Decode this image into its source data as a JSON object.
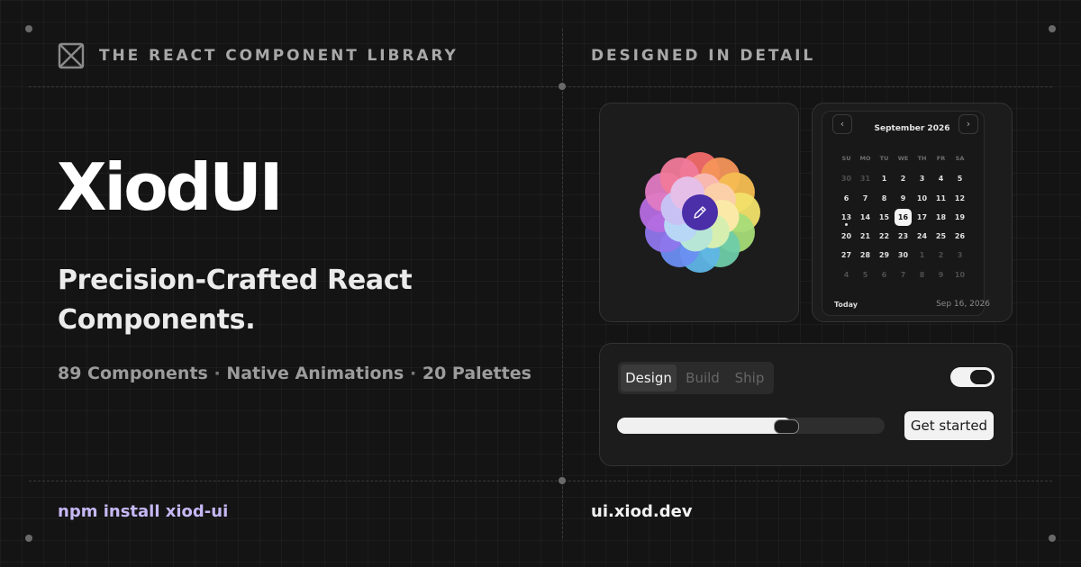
{
  "header": {
    "left_eyebrow": "THE REACT COMPONENT LIBRARY",
    "right_eyebrow": "DESIGNED IN DETAIL"
  },
  "hero": {
    "brand": "XiodUI",
    "tagline": "Precision-Crafted React Components.",
    "features": [
      "89 Components",
      "Native Animations",
      "20 Palettes"
    ],
    "separator": "·"
  },
  "footer": {
    "install": "npm install xiod-ui",
    "url": "ui.xiod.dev"
  },
  "calendar": {
    "month": "September 2026",
    "prev_icon": "chevron-left-icon",
    "next_icon": "chevron-right-icon",
    "weekdays": [
      "SU",
      "MO",
      "TU",
      "WE",
      "TH",
      "FR",
      "SA"
    ],
    "days": [
      {
        "d": "30",
        "muted": true
      },
      {
        "d": "31",
        "muted": true
      },
      {
        "d": "1"
      },
      {
        "d": "2"
      },
      {
        "d": "3"
      },
      {
        "d": "4"
      },
      {
        "d": "5"
      },
      {
        "d": "6"
      },
      {
        "d": "7"
      },
      {
        "d": "8"
      },
      {
        "d": "9"
      },
      {
        "d": "10"
      },
      {
        "d": "11"
      },
      {
        "d": "12"
      },
      {
        "d": "13",
        "today": true
      },
      {
        "d": "14"
      },
      {
        "d": "15"
      },
      {
        "d": "16",
        "selected": true
      },
      {
        "d": "17"
      },
      {
        "d": "18"
      },
      {
        "d": "19"
      },
      {
        "d": "20"
      },
      {
        "d": "21"
      },
      {
        "d": "22"
      },
      {
        "d": "23"
      },
      {
        "d": "24"
      },
      {
        "d": "25"
      },
      {
        "d": "26"
      },
      {
        "d": "27"
      },
      {
        "d": "28"
      },
      {
        "d": "29"
      },
      {
        "d": "30"
      },
      {
        "d": "1",
        "muted": true
      },
      {
        "d": "2",
        "muted": true
      },
      {
        "d": "3",
        "muted": true
      },
      {
        "d": "4",
        "muted": true
      },
      {
        "d": "5",
        "muted": true
      },
      {
        "d": "6",
        "muted": true
      },
      {
        "d": "7",
        "muted": true
      },
      {
        "d": "8",
        "muted": true
      },
      {
        "d": "9",
        "muted": true
      },
      {
        "d": "10",
        "muted": true
      }
    ],
    "today_label": "Today",
    "selected_date": "Sep 16, 2026"
  },
  "color_picker": {
    "center_icon": "pencil-icon",
    "accent": "#4a2fa8",
    "outer_colors": [
      "#f26a6a",
      "#f4955a",
      "#f5bd52",
      "#f2e16a",
      "#a7dc78",
      "#6fcca8",
      "#5fb6e6",
      "#6b8ef2",
      "#8f76ec",
      "#b66be0",
      "#e07ac3",
      "#f07a9a"
    ],
    "inner_colors": [
      "#f8b8b0",
      "#fbd0a8",
      "#fbe9a8",
      "#d6efb0",
      "#b8e6d6",
      "#b8d6f5",
      "#c8c2f4",
      "#e6bfe8"
    ]
  },
  "controls": {
    "tabs": [
      "Design",
      "Build",
      "Ship"
    ],
    "active_tab": 0,
    "toggle_on": true,
    "slider_value": 0.63,
    "cta_label": "Get started"
  },
  "colors": {
    "background": "#141414",
    "install_text": "#c6b8f5"
  }
}
